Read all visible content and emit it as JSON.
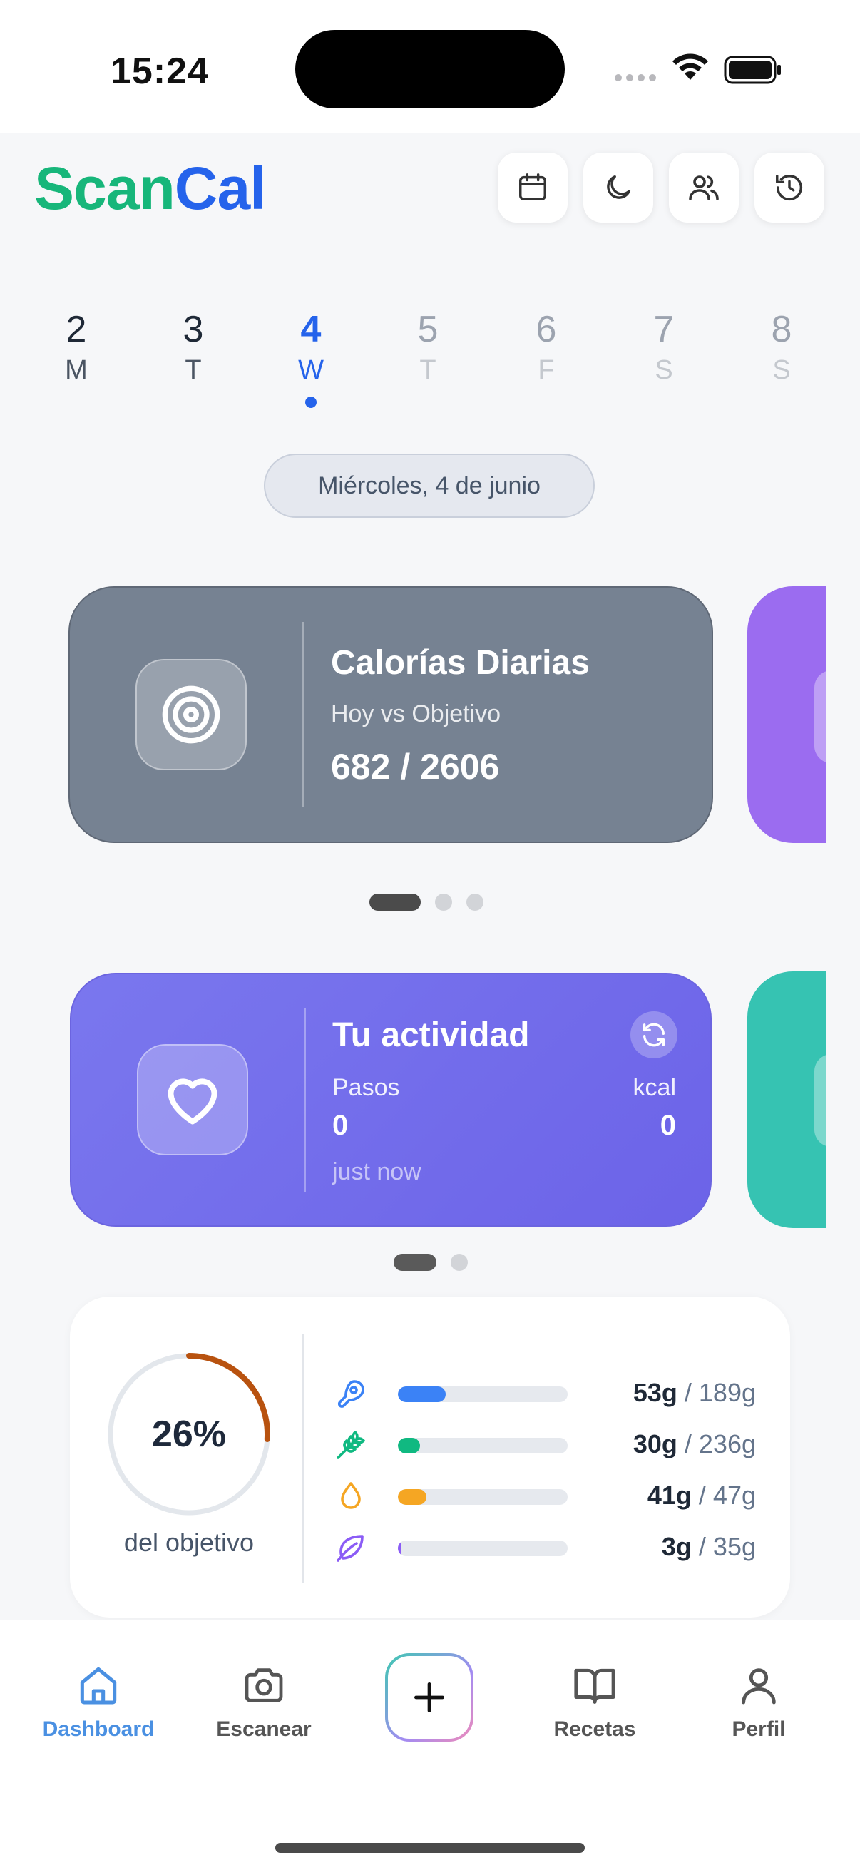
{
  "status_bar": {
    "time": "15:24"
  },
  "header": {
    "logo_part1": "Scan",
    "logo_part2": "Cal",
    "buttons": [
      "calendar-icon",
      "moon-icon",
      "users-icon",
      "history-icon"
    ]
  },
  "week": {
    "days": [
      {
        "num": "2",
        "label": "M"
      },
      {
        "num": "3",
        "label": "T"
      },
      {
        "num": "4",
        "label": "W"
      },
      {
        "num": "5",
        "label": "T"
      },
      {
        "num": "6",
        "label": "F"
      },
      {
        "num": "7",
        "label": "S"
      },
      {
        "num": "8",
        "label": "S"
      }
    ],
    "selected_index": 2
  },
  "date_pill": "Miércoles, 4 de junio",
  "calorie_card": {
    "title": "Calorías Diarias",
    "subtitle": "Hoy vs Objetivo",
    "value": "682 / 2606",
    "color": "#768292"
  },
  "activity_card": {
    "title": "Tu actividad",
    "steps_label": "Pasos",
    "steps_value": "0",
    "kcal_label": "kcal",
    "kcal_value": "0",
    "updated": "just now",
    "color": "#6f6aeb"
  },
  "macros": {
    "percent": "26%",
    "percent_value": 0.26,
    "caption": "del objetivo",
    "rows": [
      {
        "icon": "protein-icon",
        "current": "53g",
        "goal": "/ 189g",
        "fraction": 0.28,
        "color": "#3b82f6"
      },
      {
        "icon": "carbs-icon",
        "current": "30g",
        "goal": "/ 236g",
        "fraction": 0.13,
        "color": "#10b981"
      },
      {
        "icon": "fat-icon",
        "current": "41g",
        "goal": "/ 47g",
        "fraction": 0.17,
        "color": "#f5a623"
      },
      {
        "icon": "fiber-icon",
        "current": "3g",
        "goal": "/ 35g",
        "fraction": 0.02,
        "color": "#8b5cf6"
      }
    ]
  },
  "tabbar": {
    "items": [
      {
        "label": "Dashboard",
        "icon": "home-icon",
        "active": true
      },
      {
        "label": "Escanear",
        "icon": "camera-icon",
        "active": false
      },
      {
        "label": "Recetas",
        "icon": "book-icon",
        "active": false
      },
      {
        "label": "Perfil",
        "icon": "user-icon",
        "active": false
      }
    ],
    "add_icon": "plus-icon"
  }
}
